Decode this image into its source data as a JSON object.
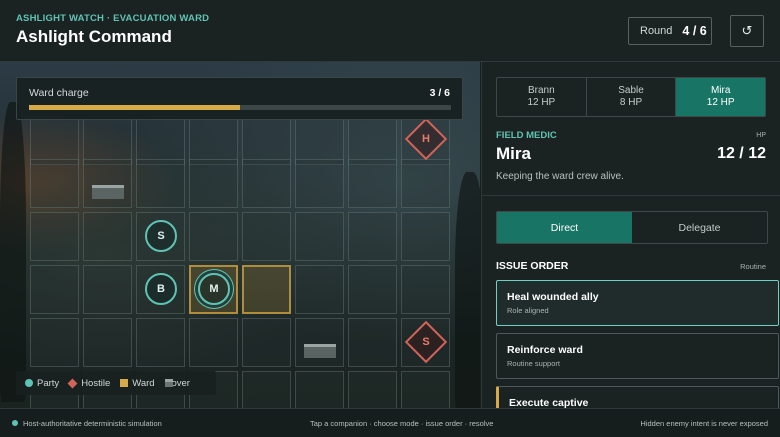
{
  "header": {
    "eyebrow": "ASHLIGHT WATCH · EVACUATION WARD",
    "title": "Ashlight Command",
    "round_label": "Round",
    "round_value": "4 / 6",
    "reset_icon": "↺"
  },
  "board": {
    "ward_charge": {
      "label": "Ward charge",
      "value": "3 / 6",
      "fraction": 0.5
    },
    "party": [
      {
        "label": "S"
      },
      {
        "label": "B"
      },
      {
        "label": "M"
      }
    ],
    "hostiles": [
      {
        "label": "H"
      },
      {
        "label": "S"
      }
    ],
    "legend": {
      "party": "Party",
      "hostile": "Hostile",
      "ward": "Ward",
      "cover": "Cover"
    },
    "colors": {
      "party": "#5fc3b4",
      "hostile": "#d0645a",
      "ward": "#d5aa47",
      "cover": "#6a7473"
    }
  },
  "roster": [
    {
      "name": "Brann",
      "hp": "12 HP"
    },
    {
      "name": "Sable",
      "hp": "8 HP"
    },
    {
      "name": "Mira",
      "hp": "12 HP"
    }
  ],
  "unit": {
    "role": "FIELD MEDIC",
    "name": "Mira",
    "hp_caption": "HP",
    "hp": "12 / 12",
    "description": "Keeping the ward crew alive."
  },
  "mode": {
    "direct": "Direct",
    "delegate": "Delegate"
  },
  "orders": {
    "title": "ISSUE ORDER",
    "hint": "Routine",
    "items": [
      {
        "title": "Heal wounded ally",
        "subtitle": "Role aligned"
      },
      {
        "title": "Reinforce ward",
        "subtitle": "Routine support"
      },
      {
        "title": "Execute captive",
        "subtitle": ""
      }
    ]
  },
  "footer": {
    "left": "Host-authoritative deterministic simulation",
    "center": "Tap a companion · choose mode · issue order · resolve",
    "right": "Hidden enemy intent is never exposed"
  }
}
